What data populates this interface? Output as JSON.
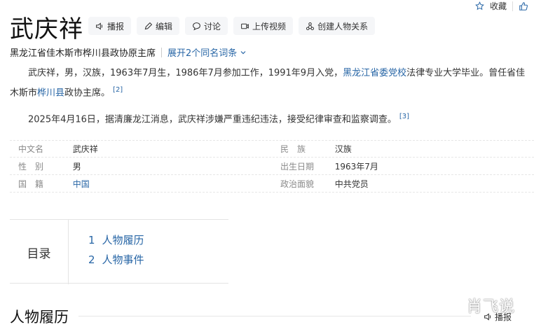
{
  "page": {
    "title": "武庆祥",
    "actions": {
      "broadcast": "播报",
      "edit": "编辑",
      "discuss": "讨论",
      "upload_video": "上传视频",
      "create_relation": "创建人物关系"
    },
    "favorite": "收藏"
  },
  "subtitle": {
    "description": "黑龙江省佳木斯市桦川县政协原主席",
    "expand": "展开2个同名词条"
  },
  "intro": {
    "p1_a": "武庆祥，男，汉族，1963年7月生，1986年7月参加工作，1991年9月入党，",
    "p1_link1": "黑龙江省委党校",
    "p1_b": "法律专业大学毕业。曾任省佳木斯市",
    "p1_link2": "桦川县",
    "p1_c": "政协主席。",
    "p1_ref": "[2]",
    "p2": "2025年4月16日，据清廉龙江消息，武庆祥涉嫌严重违纪违法，接受纪律审查和监察调查。",
    "p2_ref": "[3]"
  },
  "infobox": {
    "rows": [
      {
        "l1": "中文名",
        "v1": "武庆祥",
        "l2": "民　族",
        "v2": "汉族"
      },
      {
        "l1": "性　别",
        "v1": "男",
        "l2": "出生日期",
        "v2": "1963年7月"
      },
      {
        "l1": "国　籍",
        "v1": "中国",
        "l2": "政治面貌",
        "v2": "中共党员"
      }
    ]
  },
  "toc": {
    "label": "目录",
    "items": [
      {
        "num": "1",
        "text": "人物履历"
      },
      {
        "num": "2",
        "text": "人物事件"
      }
    ]
  },
  "section": {
    "title": "人物履历"
  },
  "overlay": {
    "watermark": "肖飞说",
    "bottom_broadcast": "播报"
  }
}
